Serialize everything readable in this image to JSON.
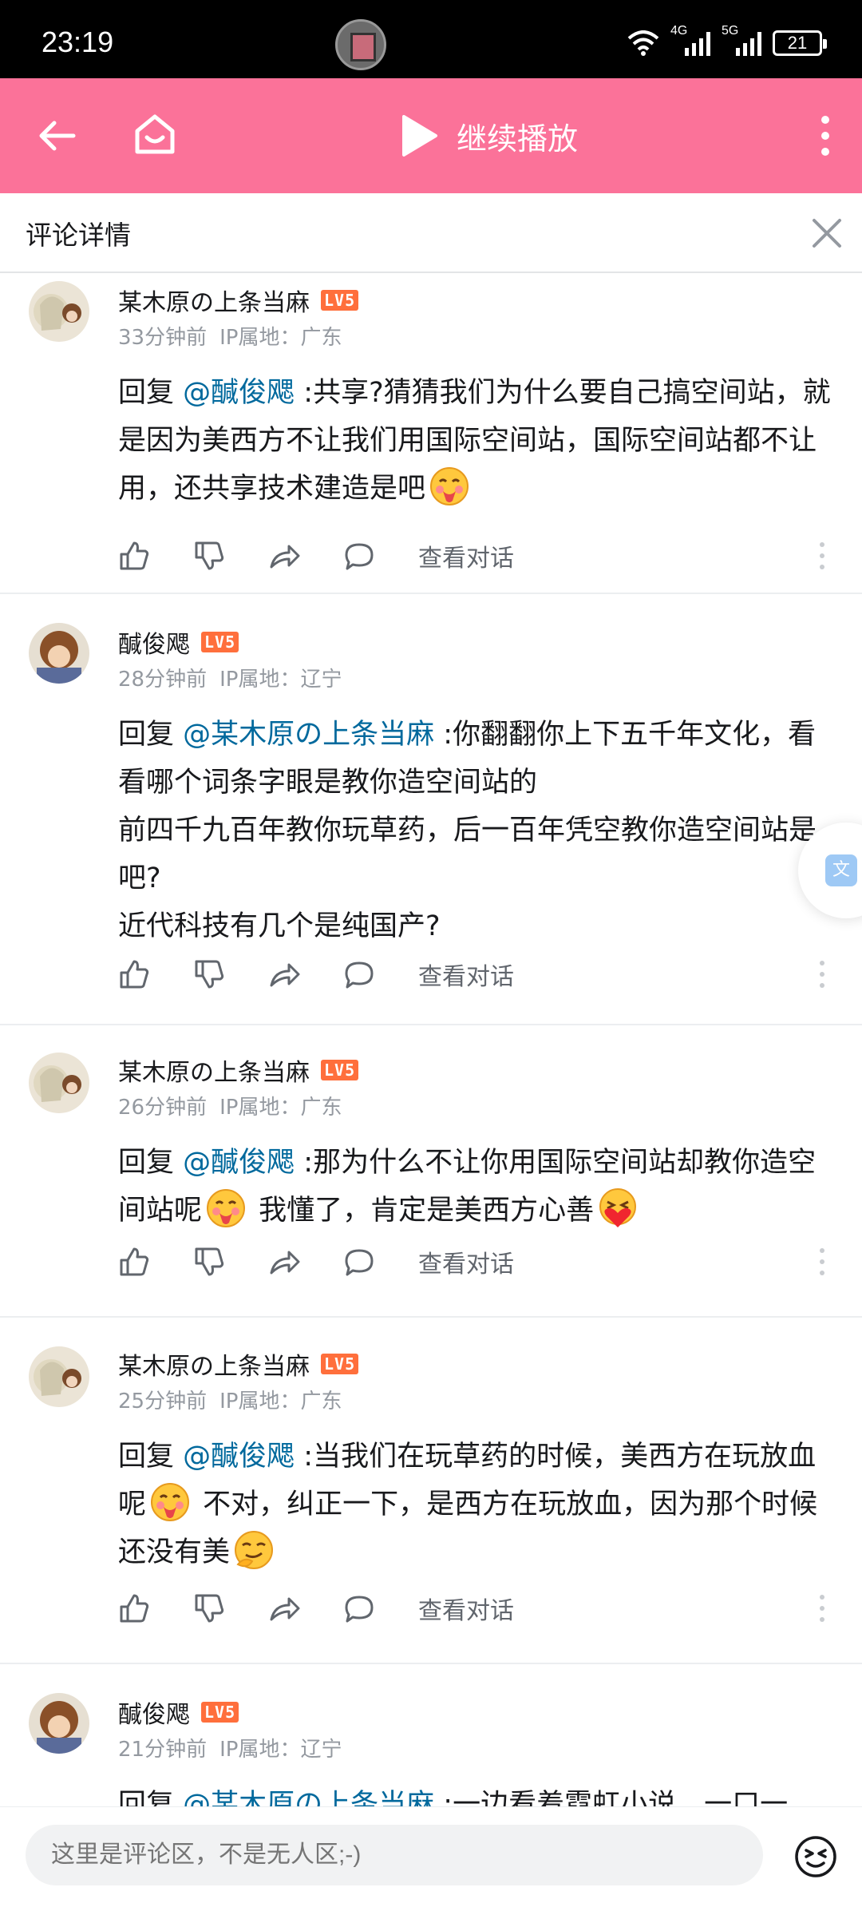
{
  "status": {
    "time": "23:19",
    "net1": "4G",
    "net2": "5G",
    "battery": "21"
  },
  "appbar": {
    "play_label": "继续播放"
  },
  "header": {
    "title": "评论详情"
  },
  "comments": [
    {
      "user": "某木原の上条当麻",
      "level": "LV5",
      "time": "33分钟前",
      "ip": "IP属地：广东",
      "reply_prefix": "回复 ",
      "mention": "@醎俊飔",
      "text1": " :共享?猜猜我们为什么要自己搞空间站，就是因为美西方不让我们用国际空间站，国际空间站都不让用，还共享技术建造是吧",
      "text2": "",
      "text3": "",
      "conv": "查看对话"
    },
    {
      "user": "醎俊飔",
      "level": "LV5",
      "time": "28分钟前",
      "ip": "IP属地：辽宁",
      "reply_prefix": "回复 ",
      "mention": "@某木原の上条当麻",
      "text1": " :你翻翻你上下五千年文化，看看哪个词条字眼是教你造空间站的\n前四千九百年教你玩草药，后一百年凭空教你造空间站是吧?\n近代科技有几个是纯国产?",
      "text2": "",
      "text3": "",
      "conv": "查看对话"
    },
    {
      "user": "某木原の上条当麻",
      "level": "LV5",
      "time": "26分钟前",
      "ip": "IP属地：广东",
      "reply_prefix": "回复 ",
      "mention": "@醎俊飔",
      "text1": " :那为什么不让你用国际空间站却教你造空间站呢",
      "text2": " 我懂了，肯定是美西方心善",
      "text3": "",
      "conv": "查看对话"
    },
    {
      "user": "某木原の上条当麻",
      "level": "LV5",
      "time": "25分钟前",
      "ip": "IP属地：广东",
      "reply_prefix": "回复 ",
      "mention": "@醎俊飔",
      "text1": " :当我们在玩草药的时候，美西方在玩放血呢",
      "text2": " 不对，纠正一下，是西方在玩放血，因为那个时候还没有美",
      "text3": "",
      "conv": "查看对话"
    },
    {
      "user": "醎俊飔",
      "level": "LV5",
      "time": "21分钟前",
      "ip": "IP属地：辽宁",
      "reply_prefix": "回复 ",
      "mention": "@某木原の上条当麻",
      "text1": " :一边看着霓虹小说，一口一",
      "text2": "",
      "text3": "",
      "conv": ""
    }
  ],
  "float_button": {
    "glyph": "文"
  },
  "input": {
    "placeholder": "这里是评论区，不是无人区;-)"
  },
  "colors": {
    "brand": "#fb7299",
    "mention": "#00699d",
    "level": "#ff6f3c"
  }
}
